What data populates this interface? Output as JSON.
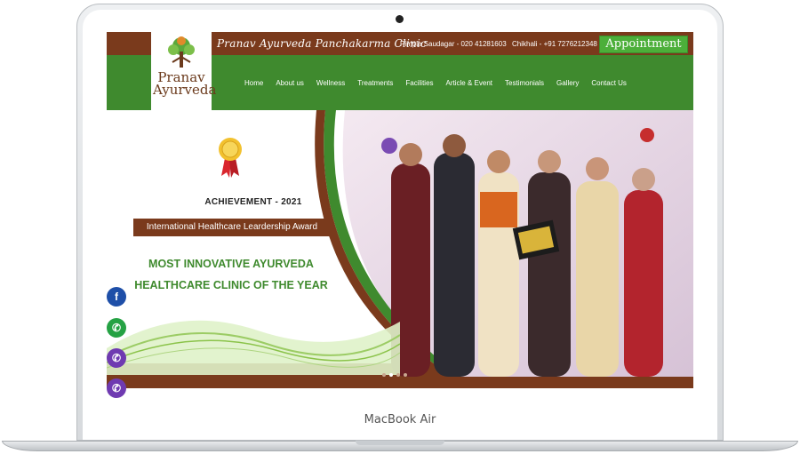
{
  "header": {
    "clinic_name": "Pranav Ayurveda Panchakarma Clinic",
    "phone_pimple": "Pimple Saudagar - 020 41281603",
    "phone_chikhali": "Chikhali - +91 7276212348",
    "appointment_label": "Appointment",
    "logo_line1": "Pranav",
    "logo_line2": "Ayurveda"
  },
  "nav": [
    "Home",
    "About us",
    "Wellness",
    "Treatments",
    "Facilities",
    "Article & Event",
    "Testimonials",
    "Gallery",
    "Contact Us"
  ],
  "slider": {
    "achievement": "ACHIEVEMENT - 2021",
    "award": "International Healthcare Leardership Award",
    "headline_line1": "MOST INNOVATIVE AYURVEDA",
    "headline_line2": "HEALTHCARE CLINIC OF THE YEAR",
    "slide_count": 4,
    "active_slide": 2
  },
  "social": {
    "facebook_glyph": "f",
    "whatsapp_glyph": "✆",
    "viber_glyph": "✆"
  },
  "device": {
    "label": "MacBook Air"
  },
  "colors": {
    "brown": "#7a3a1c",
    "green": "#3f8a2e",
    "appointment": "#4caf3a"
  },
  "icons": [
    "award-medal-icon",
    "facebook-icon",
    "whatsapp-icon",
    "viber-icon"
  ]
}
